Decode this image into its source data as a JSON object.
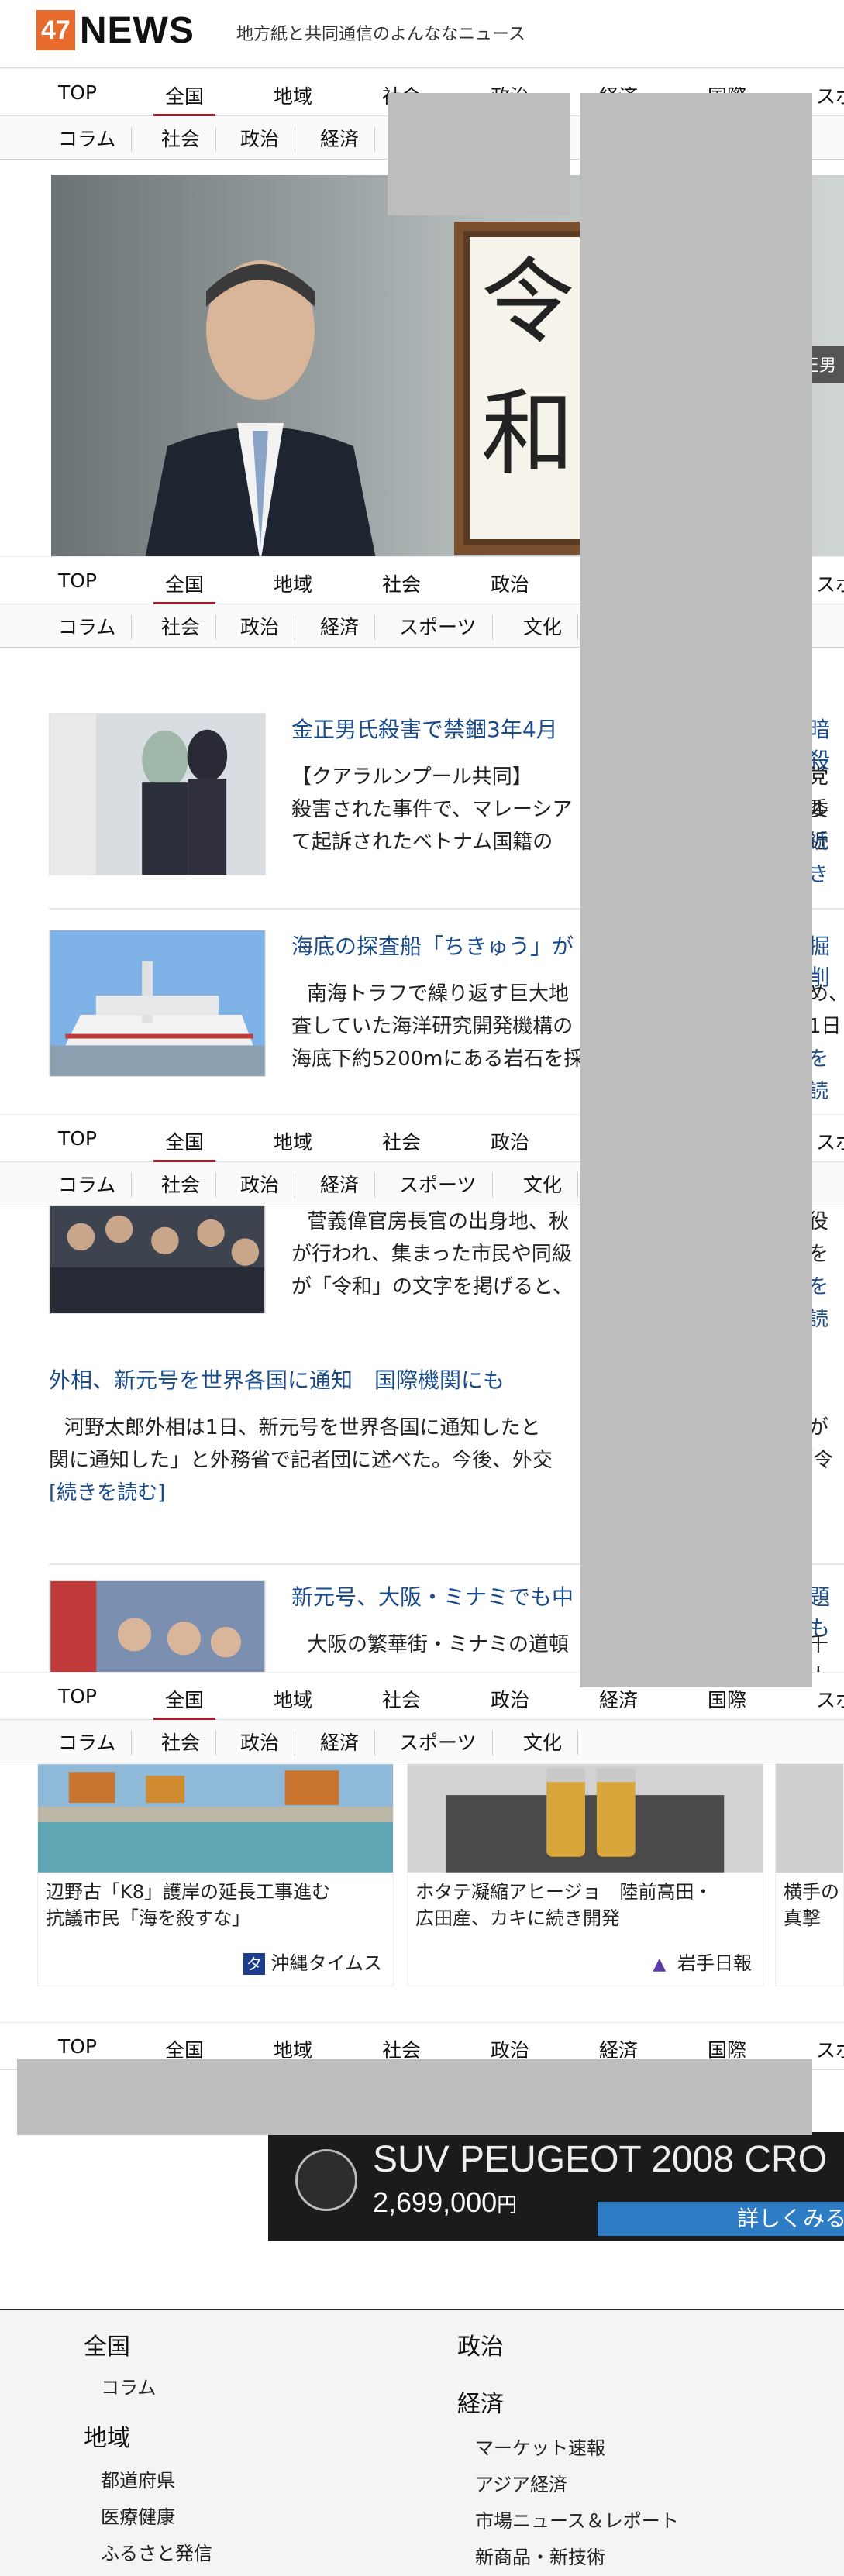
{
  "header": {
    "logo_num": "47",
    "logo_word": "NEWS",
    "tagline": "地方紙と共同通信のよんななニュース"
  },
  "nav_main": [
    "TOP",
    "全国",
    "地域",
    "社会",
    "政治",
    "経済",
    "国際",
    "スポ"
  ],
  "nav_sub": [
    "コラム",
    "社会",
    "政治",
    "経済",
    "スポーツ",
    "文化"
  ],
  "hero": {
    "frame_text": "令和",
    "tag": "正男"
  },
  "articles": [
    {
      "title": "金正男氏殺害で禁錮3年4月",
      "title_tail": "暗殺",
      "body1": "【クアラルンプール共同】",
      "body1_tail": "党委",
      "body2": "殺害された事件で、マレーシア",
      "body2_tail": "ル近",
      "body3": "て起訴されたベトナム国籍の",
      "body3_tail": "続き"
    },
    {
      "title": "海底の探査船「ちきゅう」が",
      "title_tail": "掘削",
      "body1": "南海トラフで繰り返す巨大地",
      "body1_tail": "め、",
      "body2": "査していた海洋研究開発機構の",
      "body2_tail": "1日",
      "body3": "海底下約5200mにある岩石を採",
      "body3_tail": "を読"
    },
    {
      "body1": "菅義偉官房長官の出身地、秋",
      "body1_tail": "役",
      "body2": "が行われ、集まった市民や同級",
      "body2_tail": "を",
      "body3": "が「令和」の文字を掲げると、",
      "body3_tail": "を読"
    },
    {
      "title": "外相、新元号を世界各国に通知　国際機関にも",
      "body1": "河野太郎外相は1日、新元号を世界各国に通知したと",
      "body1_tail": "が",
      "body2": "関に通知した」と外務省で記者団に述べた。今後、外交",
      "body2_tail": "「令",
      "more": "[続きを読む]"
    },
    {
      "title": "新元号、大阪・ミナミでも中",
      "title_tail": "題も",
      "body1": "大阪の繁華街・ミナミの道頓",
      "body1_tail": "千人"
    }
  ],
  "cards": [
    {
      "title1": "辺野古「K8」護岸の延長工事進む",
      "title2": "抗議市民「海を殺すな」",
      "source": "沖縄タイムス"
    },
    {
      "title1": "ホタテ凝縮アヒージョ　陸前高田・",
      "title2": "広田産、カキに続き開発",
      "source": "岩手日報"
    },
    {
      "title1": "横手の",
      "title2": "真撃"
    }
  ],
  "ad": {
    "headline": "SUV PEUGEOT 2008 CRO",
    "price": "2,699,000",
    "yen": "円",
    "cta": "詳しくみる"
  },
  "footer": {
    "col1": [
      {
        "h": "全国"
      },
      {
        "s": "コラム"
      },
      {
        "h": "地域"
      },
      {
        "s": "都道府県"
      },
      {
        "s": "医療健康"
      },
      {
        "s": "ふるさと発信"
      }
    ],
    "col2": [
      {
        "h": "政治"
      },
      {
        "h": "経済"
      },
      {
        "s": "マーケット速報"
      },
      {
        "s": "アジア経済"
      },
      {
        "s": "市場ニュース＆レポート"
      },
      {
        "s": "新商品・新技術"
      }
    ]
  }
}
